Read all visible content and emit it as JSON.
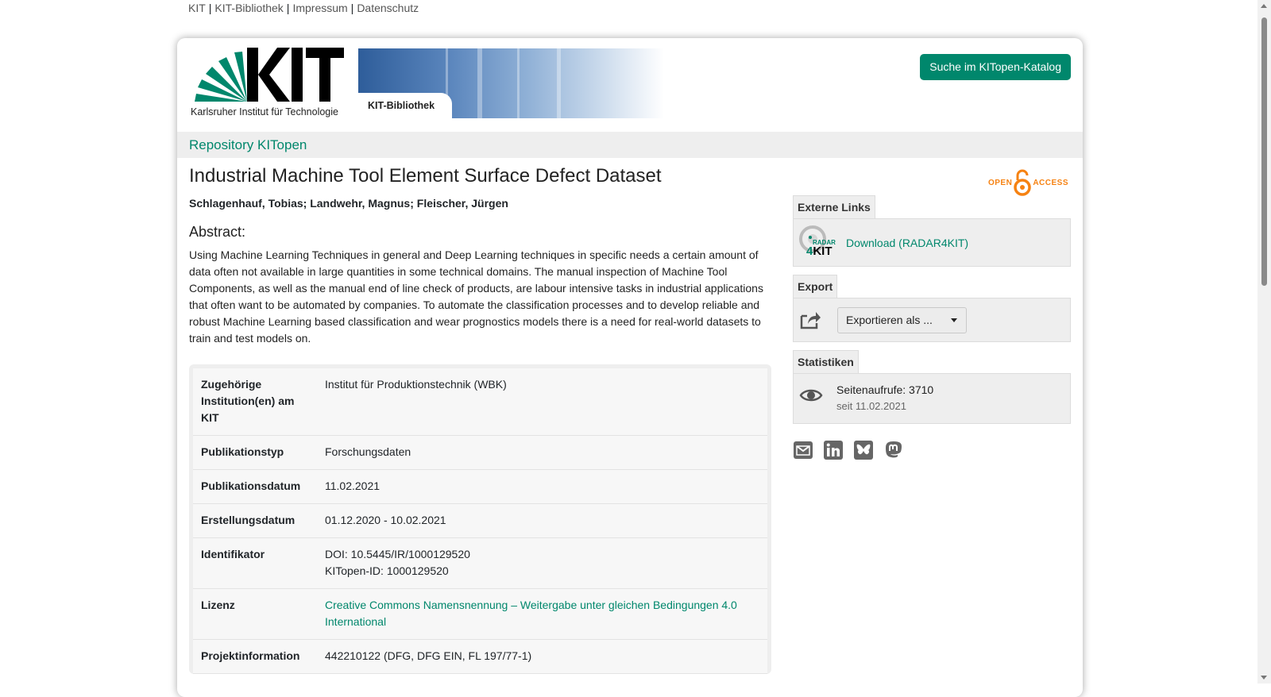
{
  "top_links": [
    "KIT",
    "KIT-Bibliothek",
    "Impressum",
    "Datenschutz"
  ],
  "top_sep": "|",
  "header": {
    "logo_caption": "Karlsruher Institut für Technologie",
    "banner_label": "KIT-Bibliothek",
    "search_button": "Suche im KITopen-Katalog"
  },
  "repo_title": "Repository KITopen",
  "record": {
    "title": "Industrial Machine Tool Element Surface Defect Dataset",
    "authors": "Schlagenhauf, Tobias; Landwehr, Magnus; Fleischer, Jürgen",
    "abstract_heading": "Abstract:",
    "abstract": "Using Machine Learning Techniques in general and Deep Learning techniques in specific needs a certain amount of data often not available in large quantities in some technical domains. The manual inspection of Machine Tool Components, as well as the manual end of line check of products, are labour intensive tasks in industrial applications that often want to be automated by companies. To automate the classification processes and to develop reliable and robust Machine Learning based classification and wear prognostics models there is a need for real-world datasets to train and test models on."
  },
  "metadata": [
    {
      "key": "Zugehörige Institution(en) am KIT",
      "value": "Institut für Produktionstechnik (WBK)"
    },
    {
      "key": "Publikationstyp",
      "value": "Forschungsdaten"
    },
    {
      "key": "Publikationsdatum",
      "value": "11.02.2021"
    },
    {
      "key": "Erstellungsdatum",
      "value": "01.12.2020 - 10.02.2021"
    },
    {
      "key": "Identifikator",
      "value": "DOI: 10.5445/IR/1000129520",
      "value2": "KITopen-ID: 1000129520"
    },
    {
      "key": "Lizenz",
      "value": "Creative Commons Namensnennung – Weitergabe unter gleichen Bedingungen 4.0 International",
      "link": true
    },
    {
      "key": "Projektinformation",
      "value": "442210122 (DFG, DFG EIN, FL 197/77-1)"
    }
  ],
  "sidebar": {
    "open_access_left": "OPEN",
    "open_access_right": "ACCESS",
    "external_tab": "Externe Links",
    "radar_top": "RADAR",
    "radar_bottom_4": "4",
    "radar_bottom_kit": "KIT",
    "download_link": "Download (RADAR4KIT)",
    "export_tab": "Export",
    "export_select": "Exportieren als ...",
    "stats_tab": "Statistiken",
    "page_views": "Seitenaufrufe: 3710",
    "since": "seit 11.02.2021",
    "share_icons": [
      "email-icon",
      "linkedin-icon",
      "bluesky-icon",
      "mastodon-icon"
    ]
  },
  "colors": {
    "accent": "#00876c",
    "open_access": "#f68212",
    "panel": "#eeeeee"
  }
}
